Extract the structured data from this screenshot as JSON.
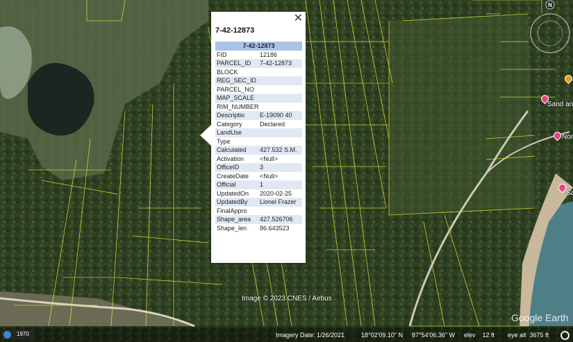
{
  "popup": {
    "close_glyph": "✕",
    "title": "7-42-12873",
    "table_header": "7-42-12873",
    "rows": [
      {
        "key": "FID",
        "value": "12186"
      },
      {
        "key": "PARCEL_ID",
        "value": "7-42-12873"
      },
      {
        "key": "BLOCK",
        "value": ""
      },
      {
        "key": "REG_SEC_ID",
        "value": ""
      },
      {
        "key": "PARCEL_NO",
        "value": ""
      },
      {
        "key": "MAP_SCALE",
        "value": ""
      },
      {
        "key": "RIM_NUMBER",
        "value": ""
      },
      {
        "key": "Descriptio",
        "value": "E-19090 40"
      },
      {
        "key": "Category",
        "value": "Declared"
      },
      {
        "key": "LandUse",
        "value": ""
      },
      {
        "key": "Type",
        "value": ""
      },
      {
        "key": "Calculated",
        "value": "427.532 S.M."
      },
      {
        "key": "Activation",
        "value": "<Null>"
      },
      {
        "key": "OfficeID",
        "value": "3"
      },
      {
        "key": "CreateDate",
        "value": "<Null>"
      },
      {
        "key": "Official",
        "value": "1"
      },
      {
        "key": "UpdatedOn",
        "value": "2020-02-25"
      },
      {
        "key": "UpdatedBy",
        "value": "Lionel Frazer"
      },
      {
        "key": "FinalAppro",
        "value": ""
      },
      {
        "key": "Shape_area",
        "value": "427.526706"
      },
      {
        "key": "Shape_len",
        "value": "86.643523"
      }
    ]
  },
  "map": {
    "attribution": "Image © 2023 CNES / Airbus",
    "compass_letter": "N",
    "places": [
      "Sand an",
      "Nor",
      "Sa"
    ],
    "logo": "Google Earth",
    "colors": {
      "parcel_line": "#e6e63a",
      "popup_header": "#a9c4e6",
      "alt_row": "#e1e8f4"
    }
  },
  "status": {
    "year": "1970",
    "imagery_date": "Imagery Date: 1/26/2021",
    "lat": "18°02'09.10\" N",
    "lon": "87°54'06.36\" W",
    "elev": "elev    12 ft",
    "eye_alt": "eye alt  3675 ft"
  }
}
